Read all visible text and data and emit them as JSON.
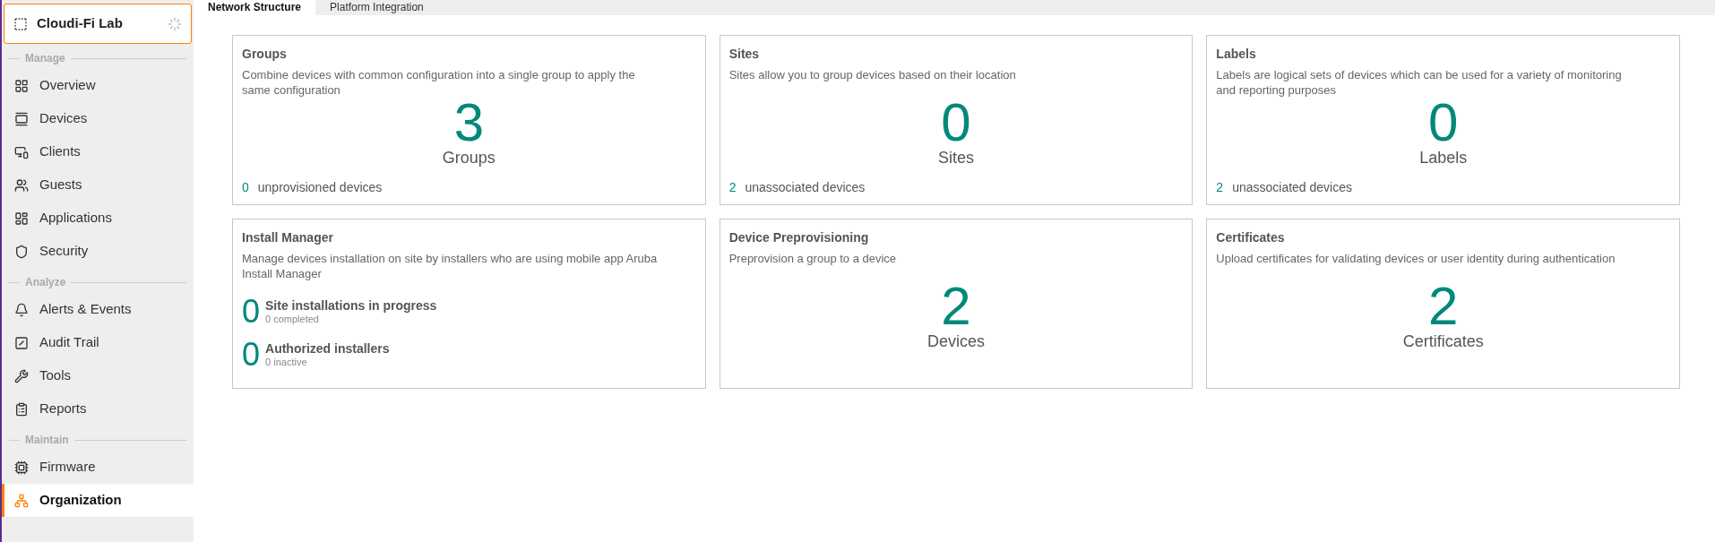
{
  "org": {
    "name": "Cloudi-Fi Lab"
  },
  "sidebar": {
    "sections": [
      {
        "title": "Manage",
        "items": [
          {
            "label": "Overview",
            "selected": false
          },
          {
            "label": "Devices",
            "selected": false
          },
          {
            "label": "Clients",
            "selected": false
          },
          {
            "label": "Guests",
            "selected": false
          },
          {
            "label": "Applications",
            "selected": false
          },
          {
            "label": "Security",
            "selected": false
          }
        ]
      },
      {
        "title": "Analyze",
        "items": [
          {
            "label": "Alerts & Events",
            "selected": false
          },
          {
            "label": "Audit Trail",
            "selected": false
          },
          {
            "label": "Tools",
            "selected": false
          },
          {
            "label": "Reports",
            "selected": false
          }
        ]
      },
      {
        "title": "Maintain",
        "items": [
          {
            "label": "Firmware",
            "selected": false
          },
          {
            "label": "Organization",
            "selected": true
          }
        ]
      }
    ]
  },
  "tabs": [
    {
      "label": "Network Structure",
      "selected": true
    },
    {
      "label": "Platform Integration",
      "selected": false
    }
  ],
  "cards": [
    {
      "kind": "count",
      "title": "Groups",
      "description": "Combine devices with common configuration into a single group to apply the same configuration",
      "value": "3",
      "unit": "Groups",
      "footer_count": "0",
      "footer_label": "unprovisioned devices"
    },
    {
      "kind": "count",
      "title": "Sites",
      "description": "Sites allow you to group devices based on their location",
      "value": "0",
      "unit": "Sites",
      "footer_count": "2",
      "footer_label": "unassociated devices"
    },
    {
      "kind": "count",
      "title": "Labels",
      "description": "Labels are logical sets of devices which can be used for a variety of monitoring and reporting purposes",
      "value": "0",
      "unit": "Labels",
      "footer_count": "2",
      "footer_label": "unassociated devices"
    },
    {
      "kind": "list",
      "title": "Install Manager",
      "description": "Manage devices installation on site by installers who are using mobile app Aruba Install Manager",
      "stats": [
        {
          "value": "0",
          "label": "Site installations in progress",
          "sub": "0 completed"
        },
        {
          "value": "0",
          "label": "Authorized installers",
          "sub": "0 inactive"
        }
      ]
    },
    {
      "kind": "count",
      "title": "Device Preprovisioning",
      "description": "Preprovision a group to a device",
      "value": "2",
      "unit": "Devices"
    },
    {
      "kind": "count",
      "title": "Certificates",
      "description": "Upload certificates for validating devices or user identity during authentication",
      "value": "2",
      "unit": "Certificates"
    }
  ]
}
